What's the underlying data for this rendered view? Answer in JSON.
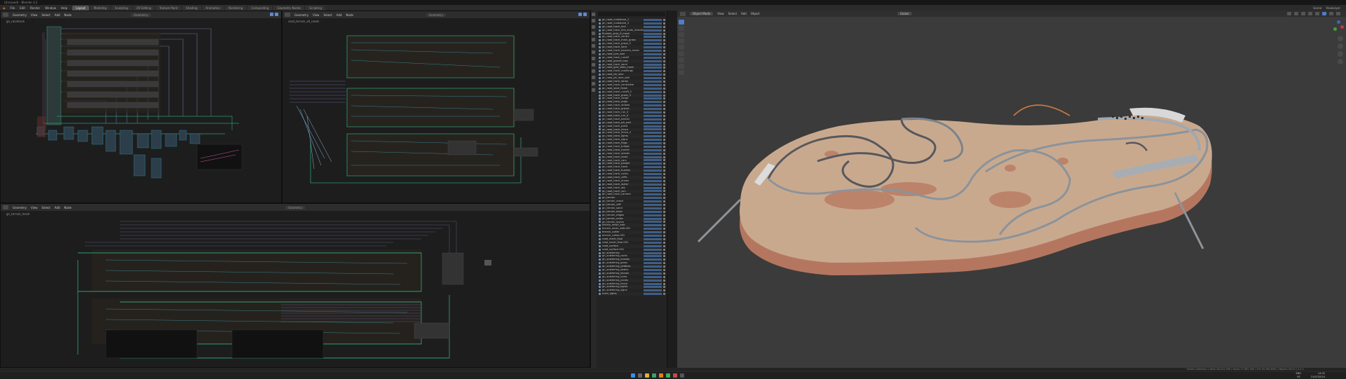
{
  "window": {
    "title_bar_text": "(Unsaved) - Blender 4.2"
  },
  "menubar": {
    "menus": [
      "File",
      "Edit",
      "Render",
      "Window",
      "Help",
      "Modeling"
    ],
    "workspace_tabs": [
      "Layout",
      "Modeling",
      "Sculpting",
      "UV Editing",
      "Texture Paint",
      "Shading",
      "Animation",
      "Rendering",
      "Compositing",
      "Geometry Nodes",
      "Scripting"
    ],
    "active_workspace": "Layout",
    "scene_label": "Scene",
    "view_layer_label": "ViewLayer"
  },
  "node_editor_header": {
    "editor_label": "Geometry",
    "menus": [
      "View",
      "Select",
      "Add",
      "Node"
    ],
    "data_block": "Geometry"
  },
  "node_editors": {
    "top_left_tree": "gn_racetrack",
    "top_right_tree": "road_terrain_all_roads",
    "bottom_tree": "gn_terrain_mesh"
  },
  "outliner": {
    "search_placeholder": "",
    "rows": [
      "gn_road_curbstone_1",
      "gn_road_curbstone_2",
      "gn_road_track_line",
      "gn_road_track_line_ends_inverted",
      "Rumble_strip_fl_mesh",
      "gn_road_track_centre",
      "gn_road_track_main_grass",
      "gn_road_track_grass_2",
      "gn_road_track_kerb",
      "gn_road_track_barriers_mesh",
      "gn_road_tyre_wall",
      "gn_road_track_runoff",
      "gn_road_gravel_trap",
      "gn_road_track_sand",
      "gn_road_grid_slots_mesh",
      "gn_road_track_markings",
      "gn_road_pit_lane",
      "gn_road_pit_lane_exit",
      "gn_road_track_kerbs",
      "gn_road_track_centreline",
      "gn_road_start_finish",
      "gn_road_track_runoff_2",
      "gn_road_track_grass_3",
      "gn_road_track_verge",
      "gn_road_track_edge",
      "gn_road_track_stripes",
      "gn_road_track_gravel",
      "gn_road_track_run_3",
      "gn_road_track_run_4",
      "gn_road_track_barrier",
      "gn_road_track_pit_wall",
      "gn_road_track_paint",
      "gn_road_track_fence",
      "gn_road_track_fence_2",
      "gn_road_track_lights",
      "gn_road_track_signs",
      "gn_road_track_flags",
      "gn_road_track_bridge",
      "gn_road_track_tunnel",
      "gn_road_track_stands",
      "gn_road_track_tents",
      "gn_road_track_cars",
      "gn_road_track_people",
      "gn_road_track_trees",
      "gn_road_track_bushes",
      "gn_road_track_rocks",
      "gn_road_track_cliffs",
      "gn_road_track_dunes",
      "gn_road_track_water",
      "gn_road_track_sky",
      "gn_road_track_sun",
      "gn_road_track_camera",
      "gn_terrain",
      "gn_terrain_mesh",
      "gn_terrain_cliff",
      "gn_terrain_sand",
      "gn_terrain_base",
      "gn_terrain_edges",
      "gn_terrain_noise",
      "gn_terrain_layers",
      "terrain_mesh_edit",
      "terrain_mesh_edit.001",
      "terrain_cutter",
      "terrain_cutter.001",
      "road_mesh_final",
      "road_mesh_final.001",
      "road_surface",
      "road_surface.001",
      "gn_scattering",
      "gn_scattering_rocks",
      "gn_scattering_bushes",
      "gn_scattering_grass",
      "gn_scattering_pebbles",
      "gn_scattering_debris",
      "gn_scattering_stones",
      "gn_scattering_tyres",
      "gn_scattering_cones",
      "gn_scattering_fence",
      "gn_scattering_lights",
      "gn_scattering_signs",
      "track_lights"
    ]
  },
  "viewport": {
    "editor_label": "Object Mode",
    "menus": [
      "View",
      "Select",
      "Add",
      "Object"
    ],
    "orientation": "Global"
  },
  "statusbar": {
    "stats_text": "Scene Collection | Verts 28,412,590 | Faces 27,981,304 | Tris 55,962,608 | Objects 0/214 | 4.2.1"
  },
  "taskbar": {
    "lang_top": "ENG",
    "lang_bottom": "US",
    "time": "14:32",
    "date": "21/07/2024"
  },
  "colors": {
    "accent": "#4d7ecb",
    "terrain": "#c9a98e",
    "cliff": "#b8775f",
    "road": "#7b838c",
    "node_green": "#2e9a73",
    "node_teal": "#3a7f8a"
  }
}
